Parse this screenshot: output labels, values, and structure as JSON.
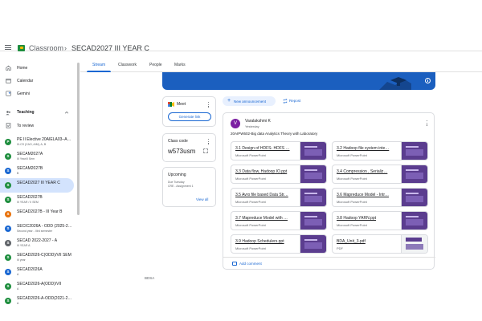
{
  "header": {
    "app_name": "Classroom",
    "separator": "›",
    "class_name": "SECAD2027 III YEAR C"
  },
  "sidebar": {
    "items": [
      {
        "label": "Home",
        "icon": "home-icon"
      },
      {
        "label": "Calendar",
        "icon": "calendar-icon"
      },
      {
        "label": "Gemini",
        "icon": "gemini-icon"
      }
    ],
    "teaching_label": "Teaching",
    "to_review_label": "To review",
    "classes": [
      {
        "initial": "P",
        "color": "#1e8e3e",
        "name": "PE II Elective 20AIELA03–A…",
        "sub": "III-CS (CAO, AIM), A, B"
      },
      {
        "initial": "S",
        "color": "#1e8e3e",
        "name": "SECAM2027A",
        "sub": "III Year/II Sem"
      },
      {
        "initial": "S",
        "color": "#1967d2",
        "name": "SECAM2027B",
        "sub": "B"
      },
      {
        "initial": "S",
        "color": "#1e8e3e",
        "name": "SECAD2027 III YEAR C",
        "sub": "",
        "active": true
      },
      {
        "initial": "S",
        "color": "#1e8e3e",
        "name": "SECAD2027B",
        "sub": "III YEAR / II SEM"
      },
      {
        "initial": "S",
        "color": "#e8710a",
        "name": "SECAD2027B - III Year B",
        "sub": ""
      },
      {
        "initial": "S",
        "color": "#1967d2",
        "name": "SECIC2026A - ODD (2025-2…",
        "sub": "Second year - IIIrd semester"
      },
      {
        "initial": "S",
        "color": "#5f6368",
        "name": "SECAD 2022-2027 - A",
        "sub": "III YEAR A"
      },
      {
        "initial": "S",
        "color": "#1e8e3e",
        "name": "SECAD2026-C(ODD)/VII SEM",
        "sub": "III year"
      },
      {
        "initial": "S",
        "color": "#1967d2",
        "name": "SECAD2026A",
        "sub": "A"
      },
      {
        "initial": "S",
        "color": "#1e8e3e",
        "name": "SECAD2026-A(ODD)/VII",
        "sub": "A"
      },
      {
        "initial": "S",
        "color": "#1e8e3e",
        "name": "SECAD2026-A-ODD(2021-2…",
        "sub": "A"
      }
    ]
  },
  "tabs": [
    "Stream",
    "Classwork",
    "People",
    "Marks"
  ],
  "meet": {
    "title": "Meet",
    "button": "Generate link"
  },
  "class_code": {
    "title": "Class code",
    "code": "w573usm"
  },
  "upcoming": {
    "title": "Upcoming",
    "line1": "Due Tuesday",
    "line2": "CRE - Assignment 1",
    "view_all": "View all"
  },
  "composer": {
    "new_announcement": "New announcement",
    "repost": "Repost"
  },
  "post": {
    "avatar_initial": "V",
    "author": "Varalakshmi K",
    "time": "Yesterday",
    "text": "20AIPW602-Big data Analytics Theory with Laboratory",
    "attachments": [
      {
        "name": "3.1 Design of HDFS- HDFS …",
        "type": "Microsoft PowerPoint"
      },
      {
        "name": "3.2 Hadoop file system inte…",
        "type": "Microsoft PowerPoint"
      },
      {
        "name": "3.3 Data flow, Hadoop IO.ppt",
        "type": "Microsoft PowerPoint"
      },
      {
        "name": "3.4 Compression , Serializ…",
        "type": "Microsoft PowerPoint"
      },
      {
        "name": "3.5 Avro file based Data Str…",
        "type": "Microsoft PowerPoint"
      },
      {
        "name": "3.6 Mapreduce Model - Intr…",
        "type": "Microsoft PowerPoint"
      },
      {
        "name": "3.7 Mapreduce Model with …",
        "type": "Microsoft PowerPoint"
      },
      {
        "name": "3.8 Hadoop YARN.ppt",
        "type": "Microsoft PowerPoint"
      },
      {
        "name": "3.9 Hadoop Schedulers.ppt",
        "type": "Microsoft PowerPoint"
      },
      {
        "name": "BDA_Unit_3.pdf",
        "type": "PDF"
      }
    ],
    "add_comment": "Add comment"
  },
  "next_peek": "BDSA"
}
